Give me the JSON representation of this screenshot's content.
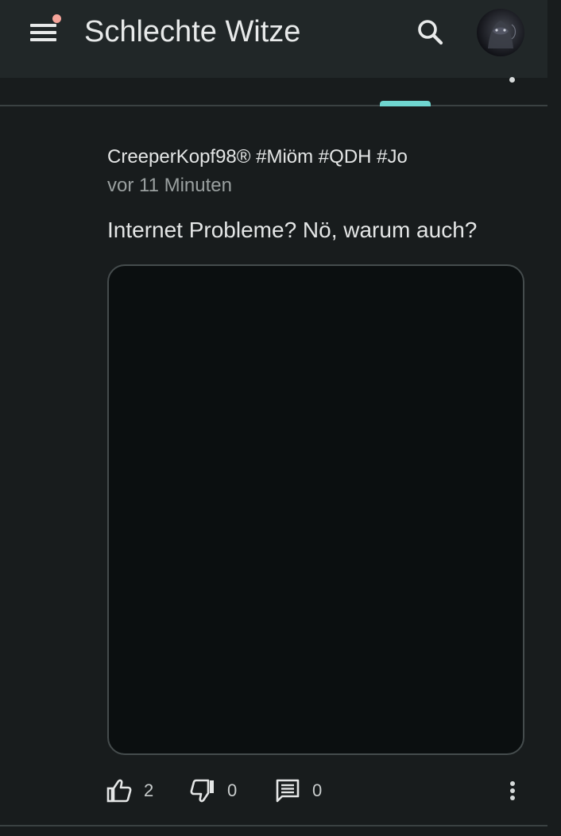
{
  "app": {
    "title": "Schlechte Witze"
  },
  "icons": {
    "menu": "menu-icon",
    "search": "search-icon",
    "like": "thumb-up-icon",
    "dislike": "thumb-down-icon",
    "comment": "comment-icon",
    "more": "more-vert-icon"
  },
  "colors": {
    "accent": "#6fd6d0",
    "notification": "#f5a49a",
    "background": "#181c1d",
    "appbar": "#212728"
  },
  "post": {
    "author": "CreeperKopf98® #Miöm #QDH #Jo",
    "timestamp": "vor 11 Minuten",
    "text": "Internet Probleme? Nö, warum auch?",
    "likes": "2",
    "dislikes": "0",
    "comments": "0"
  }
}
